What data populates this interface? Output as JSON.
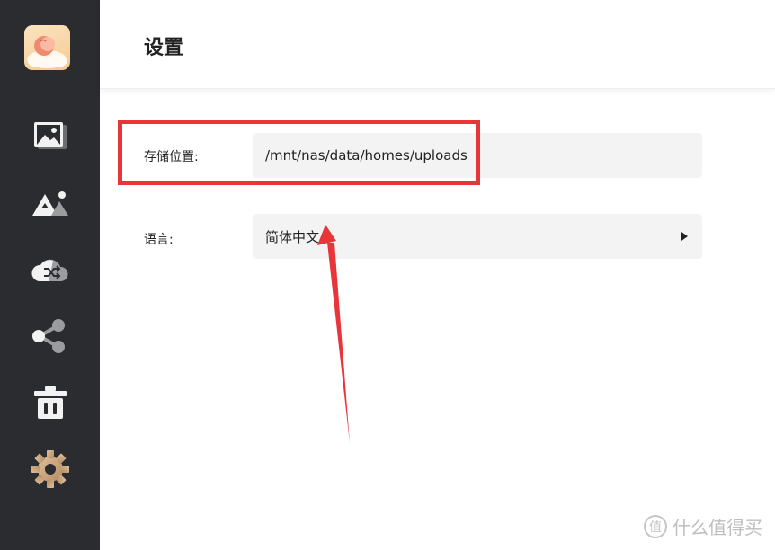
{
  "app": {
    "logo": "app-logo"
  },
  "sidebar": {
    "items": [
      {
        "name": "photos",
        "icon": "image-gallery-icon"
      },
      {
        "name": "albums",
        "icon": "mountain-icon"
      },
      {
        "name": "sync",
        "icon": "cloud-sync-icon"
      },
      {
        "name": "share",
        "icon": "share-icon"
      },
      {
        "name": "trash",
        "icon": "trash-icon"
      },
      {
        "name": "settings",
        "icon": "gear-icon",
        "active": true
      }
    ]
  },
  "header": {
    "title": "设置"
  },
  "settings": {
    "storage": {
      "label": "存储位置:",
      "value": "/mnt/nas/data/homes/uploads"
    },
    "language": {
      "label": "语言:",
      "value": "简体中文"
    }
  },
  "annotation": {
    "color": "#e8353a"
  },
  "watermark": {
    "badge": "值",
    "text": "什么值得买"
  },
  "colors": {
    "sidebar_bg": "#2a2c30",
    "field_bg": "#f3f3f3",
    "active_icon": "#c9a27a"
  }
}
